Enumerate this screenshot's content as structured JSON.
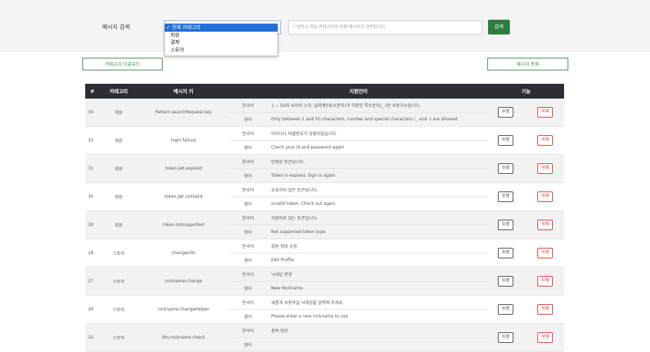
{
  "search": {
    "label": "메시지 검색",
    "category_selected": "전체 카테고리",
    "options": [
      "전체 카테고리",
      "회원",
      "결제",
      "스토어"
    ],
    "input_placeholder": "* 입력시 하당 카테고리의 전체 메시지가 검색됩니다.",
    "button": "검색"
  },
  "toolbar": {
    "download_label": "카테고리 다운로드",
    "register_label": "메시지 등록"
  },
  "table": {
    "headers": [
      "#",
      "카테고리",
      "메시지 키",
      "지원언어",
      "기능"
    ],
    "edit_label": "수정",
    "delete_label": "삭제",
    "rows": [
      {
        "num": "34",
        "category": "회원",
        "key": "Pattern.searchRequest.key",
        "ko_label": "한국어",
        "ko_text": "1 ~ 50자 사이의 소자, 알파벳(대/소문자)과 허용된 특수문자(_-)만 사용가능합니다.",
        "en_label": "영어",
        "en_text": "Only between 1 and 50 characters, number and special characters (_ and -) are allowed."
      },
      {
        "num": "32",
        "category": "회원",
        "key": "login.failure",
        "ko_label": "한국어",
        "ko_text": "아이디나 비밀번호가 상황되었습니다.",
        "en_label": "영어",
        "en_text": "Check your Id and password again"
      },
      {
        "num": "31",
        "category": "회원",
        "key": "token.jwt.expired",
        "ko_label": "한국어",
        "ko_text": "만료된 토큰입니다.",
        "en_label": "영어",
        "en_text": "Token is expired. Sign in again"
      },
      {
        "num": "30",
        "category": "회원",
        "key": "token.jwt.notValid",
        "ko_label": "한국어",
        "ko_text": "유효하지 않은 토큰입니다.",
        "en_label": "영어",
        "en_text": "Invalid token. Check out again"
      },
      {
        "num": "29",
        "category": "회원",
        "key": "token.notsupported",
        "ko_label": "한국어",
        "ko_text": "지원하지 않는 토큰입니다.",
        "en_label": "영어",
        "en_text": "Not supported token type"
      },
      {
        "num": "28",
        "category": "스토어",
        "key": "changeinfo",
        "ko_label": "한국어",
        "ko_text": "회원 정보 수정",
        "en_label": "영어",
        "en_text": "Edit Profile"
      },
      {
        "num": "27",
        "category": "스토어",
        "key": "nickname.change",
        "ko_label": "한국어",
        "ko_text": "닉네임 변경",
        "en_label": "영어",
        "en_text": "New Nickname"
      },
      {
        "num": "26",
        "category": "스토어",
        "key": "nickname.changeHelper",
        "ko_label": "한국어",
        "ko_text": "새롭게 사용하실 닉네임을 입력해 주세요.",
        "en_label": "영어",
        "en_text": "Please enter a new nickname to use"
      },
      {
        "num": "25",
        "category": "스토어",
        "key": "btn.nickname.check",
        "ko_label": "한국어",
        "ko_text": "중복 확인",
        "en_label": "영어",
        "en_text": ""
      }
    ]
  }
}
